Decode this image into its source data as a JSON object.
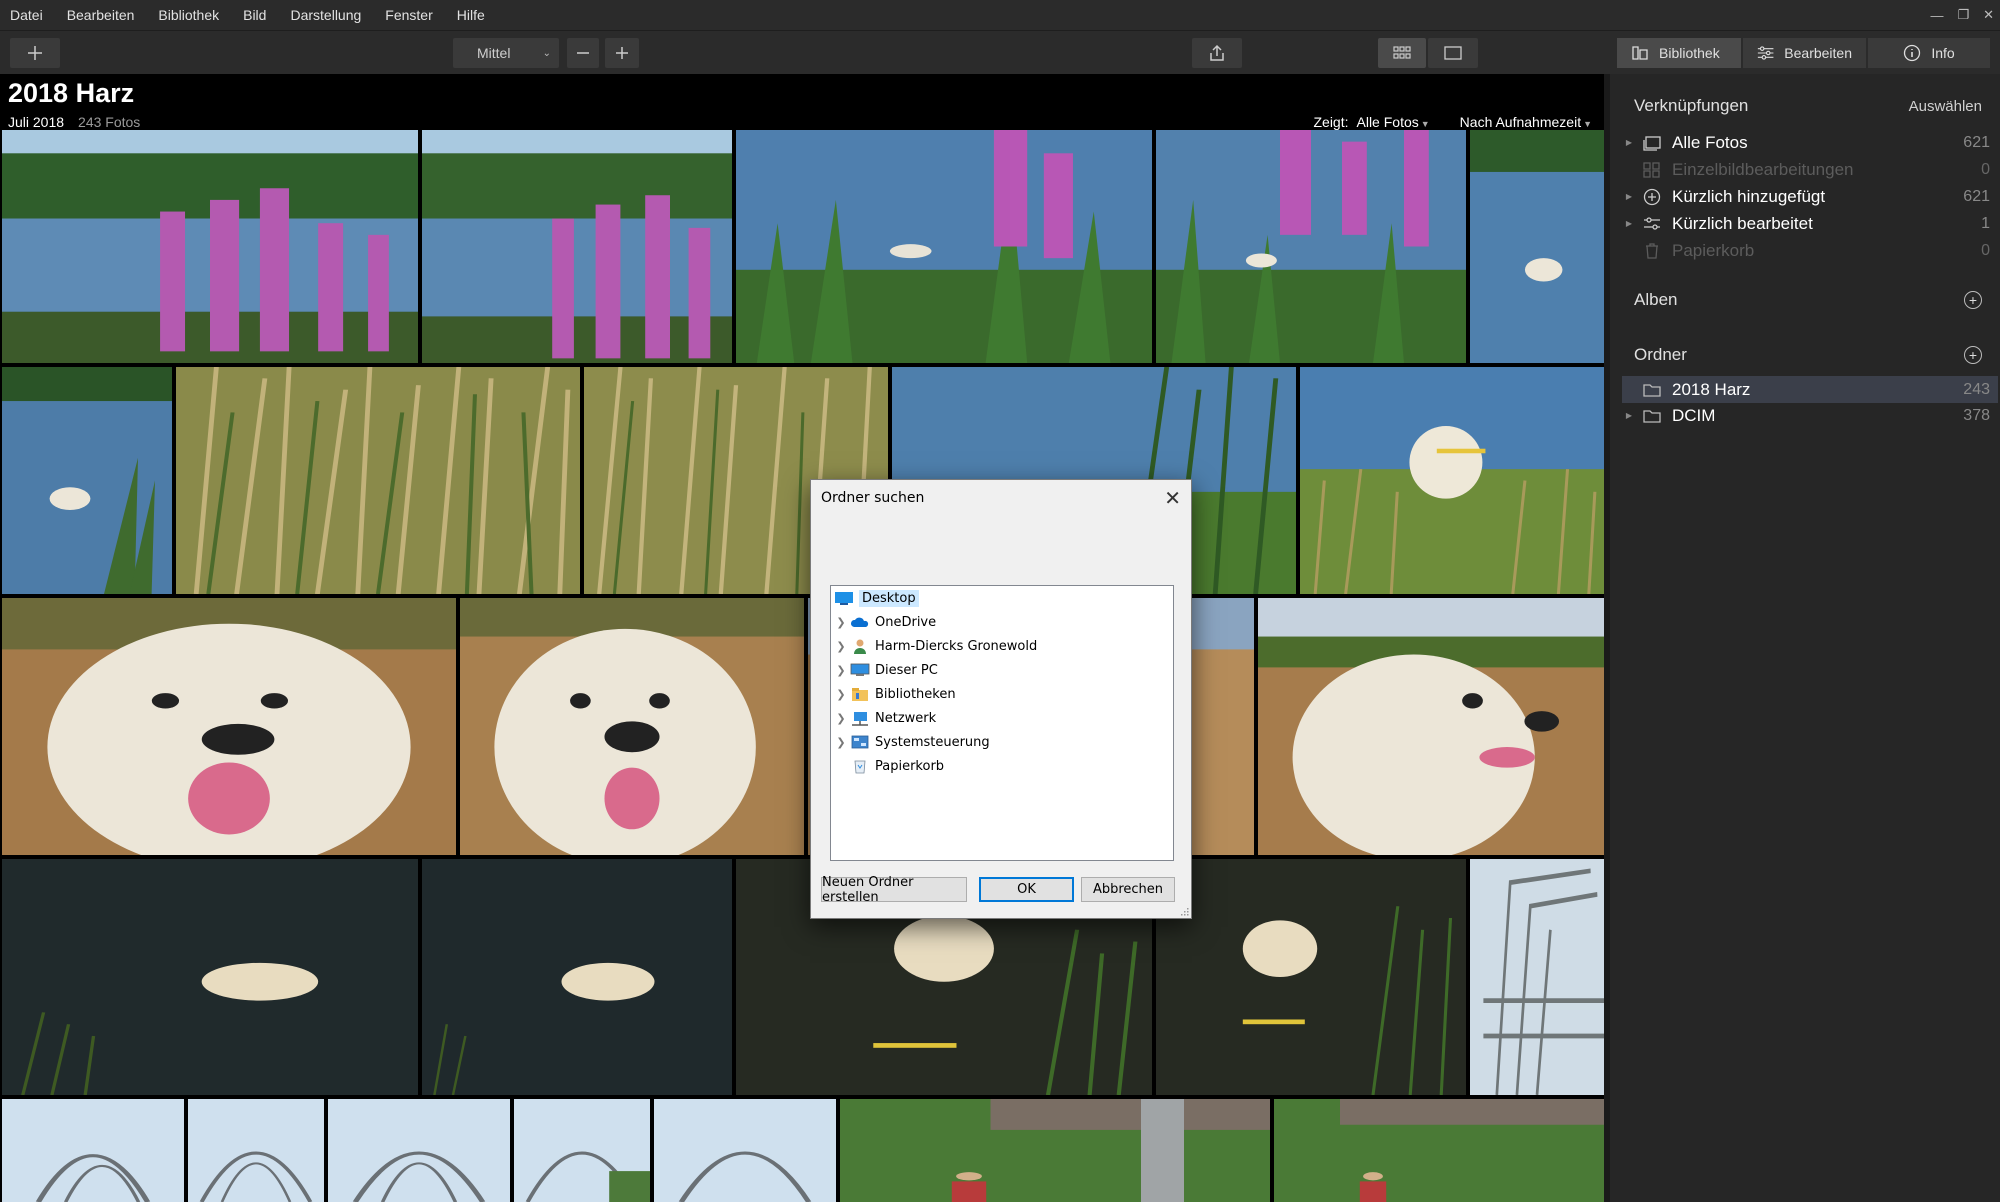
{
  "menu": [
    "Datei",
    "Bearbeiten",
    "Bibliothek",
    "Bild",
    "Darstellung",
    "Fenster",
    "Hilfe"
  ],
  "toolbar": {
    "size_select": "Mittel",
    "tabs": {
      "library": "Bibliothek",
      "edit": "Bearbeiten",
      "info": "Info"
    }
  },
  "album": {
    "title": "2018 Harz",
    "month": "Juli 2018",
    "count": "243 Fotos",
    "shows_label": "Zeigt:",
    "filter": "Alle Fotos",
    "sort": "Nach Aufnahmezeit"
  },
  "sidebar": {
    "shortcuts_title": "Verknüpfungen",
    "select_action": "Auswählen",
    "shortcuts": [
      {
        "label": "Alle Fotos",
        "count": "621",
        "icon": "photos-icon"
      },
      {
        "label": "Einzelbildbearbeitungen",
        "count": "0",
        "icon": "grid-icon"
      },
      {
        "label": "Kürzlich hinzugefügt",
        "count": "621",
        "icon": "plus-circle-icon"
      },
      {
        "label": "Kürzlich bearbeitet",
        "count": "1",
        "icon": "sliders-icon"
      },
      {
        "label": "Papierkorb",
        "count": "0",
        "icon": "trash-icon"
      }
    ],
    "albums_title": "Alben",
    "folders_title": "Ordner",
    "folders": [
      {
        "label": "2018 Harz",
        "count": "243"
      },
      {
        "label": "DCIM",
        "count": "378"
      }
    ]
  },
  "dialog": {
    "title": "Ordner suchen",
    "tree": [
      {
        "label": "Desktop",
        "icon": "desktop-icon"
      },
      {
        "label": "OneDrive",
        "icon": "cloud-icon"
      },
      {
        "label": "Harm-Diercks Gronewold",
        "icon": "user-icon"
      },
      {
        "label": "Dieser PC",
        "icon": "computer-icon"
      },
      {
        "label": "Bibliotheken",
        "icon": "library-folder-icon"
      },
      {
        "label": "Netzwerk",
        "icon": "network-icon"
      },
      {
        "label": "Systemsteuerung",
        "icon": "control-panel-icon"
      },
      {
        "label": "Papierkorb",
        "icon": "recycle-bin-icon"
      }
    ],
    "buttons": {
      "new_folder": "Neuen Ordner erstellen",
      "ok": "OK",
      "cancel": "Abbrechen"
    }
  },
  "colors": {
    "selection": "#e3b54a",
    "dialog_accent": "#0078d7",
    "sidebar_bg": "#262626"
  }
}
